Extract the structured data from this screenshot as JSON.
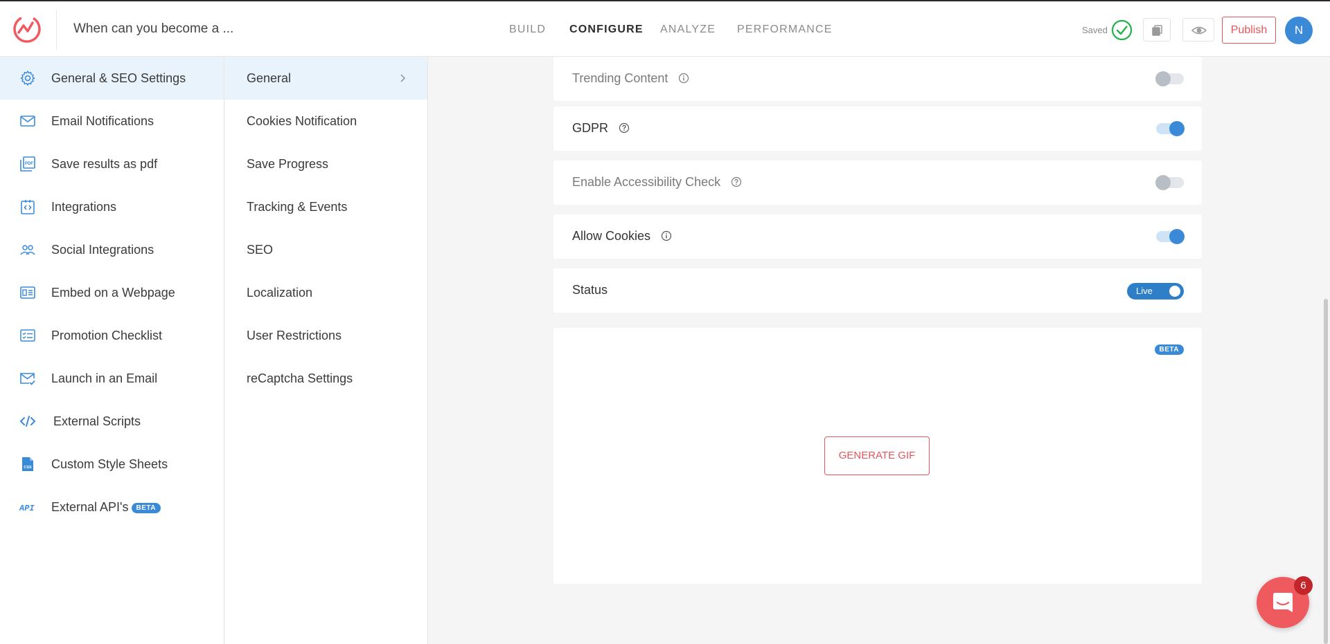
{
  "header": {
    "quiz_title": "When can you become a ...",
    "nav": [
      "BUILD",
      "CONFIGURE",
      "ANALYZE",
      "PERFORMANCE"
    ],
    "active_nav": "CONFIGURE",
    "saved_label": "Saved",
    "publish_label": "Publish",
    "avatar_initial": "N"
  },
  "sidebar": {
    "items": [
      {
        "label": "General & SEO Settings",
        "icon": "gear-icon",
        "active": true
      },
      {
        "label": "Email Notifications",
        "icon": "envelope-icon"
      },
      {
        "label": "Save results as pdf",
        "icon": "pdf-icon"
      },
      {
        "label": "Integrations",
        "icon": "integrations-icon"
      },
      {
        "label": "Social Integrations",
        "icon": "users-icon"
      },
      {
        "label": "Embed on a Webpage",
        "icon": "embed-icon"
      },
      {
        "label": "Promotion Checklist",
        "icon": "checklist-icon"
      },
      {
        "label": "Launch in an Email",
        "icon": "email-check-icon"
      },
      {
        "label": "External Scripts",
        "icon": "code-icon"
      },
      {
        "label": "Custom Style Sheets",
        "icon": "css-file-icon"
      },
      {
        "label": "External API's",
        "icon": "api-icon",
        "badge": "BETA"
      }
    ]
  },
  "submenu": {
    "items": [
      {
        "label": "General",
        "active": true
      },
      {
        "label": "Cookies Notification"
      },
      {
        "label": "Save Progress"
      },
      {
        "label": "Tracking & Events"
      },
      {
        "label": "SEO"
      },
      {
        "label": "Localization"
      },
      {
        "label": "User Restrictions"
      },
      {
        "label": "reCaptcha Settings"
      }
    ]
  },
  "settings": [
    {
      "label": "Trending Content",
      "info_icon": "info-icon",
      "enabled": false
    },
    {
      "label": "GDPR",
      "info_icon": "help-icon",
      "enabled": true
    },
    {
      "label": "Enable Accessibility Check",
      "info_icon": "help-icon",
      "enabled": false
    },
    {
      "label": "Allow Cookies",
      "info_icon": "info-icon",
      "enabled": true
    }
  ],
  "status": {
    "label": "Status",
    "value": "Live"
  },
  "gif_card": {
    "beta_label": "BETA",
    "button_label": "GENERATE GIF"
  },
  "chat": {
    "unread_count": "6"
  },
  "colors": {
    "accent": "#3a8ad8",
    "brand_red": "#e8545a",
    "success": "#22b04b",
    "chat_badge": "#c2262b"
  }
}
